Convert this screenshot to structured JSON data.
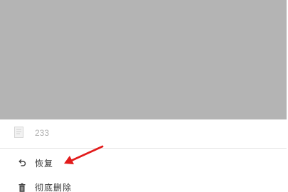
{
  "file": {
    "name": "233",
    "icon": "document-icon"
  },
  "menu": {
    "items": [
      {
        "label": "恢复",
        "icon": "undo-icon"
      },
      {
        "label": "彻底删除",
        "icon": "trash-icon"
      }
    ]
  },
  "colors": {
    "preview_bg": "#b4b4b4",
    "annotation": "#e21b1b"
  }
}
